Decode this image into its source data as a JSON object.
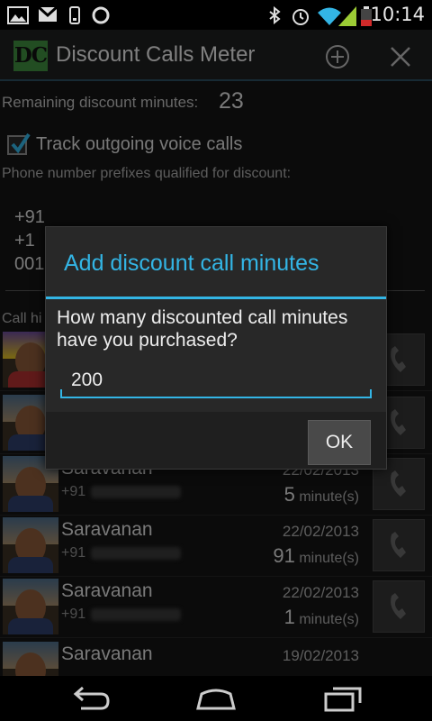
{
  "status_bar": {
    "time": "10:14",
    "left_icons": [
      "image-icon",
      "gmail-icon",
      "phone-battery-icon",
      "lifebuoy-icon"
    ],
    "right_icons": [
      "bluetooth-icon",
      "alarm-icon",
      "wifi-icon",
      "signal-icon",
      "battery-icon"
    ],
    "battery_color": "#d12a2a"
  },
  "action_bar": {
    "logo_text": "DC",
    "title": "Discount Calls Meter",
    "add_icon": "add-circle-icon",
    "close_icon": "close-icon",
    "accent": "#33b5e5"
  },
  "main": {
    "remaining_label": "Remaining discount minutes:",
    "remaining_value": "23",
    "track_label": "Track outgoing voice calls",
    "track_checked": true,
    "prefix_label": "Phone number prefixes qualified for discount:",
    "prefixes": [
      "+91",
      "+1",
      "001"
    ],
    "call_history_label": "Call hi"
  },
  "call_rows": [
    {
      "name": "",
      "number_prefix": "",
      "date": "",
      "minutes": "",
      "unit": ""
    },
    {
      "name": "",
      "number_prefix": "",
      "date": "",
      "minutes": "",
      "unit": ""
    },
    {
      "name": "Saravanan",
      "number_prefix": "+91",
      "date": "22/02/2013",
      "minutes": "5",
      "unit": "minute(s)"
    },
    {
      "name": "Saravanan",
      "number_prefix": "+91",
      "date": "22/02/2013",
      "minutes": "91",
      "unit": "minute(s)"
    },
    {
      "name": "Saravanan",
      "number_prefix": "+91",
      "date": "22/02/2013",
      "minutes": "1",
      "unit": "minute(s)"
    },
    {
      "name": "Saravanan",
      "number_prefix": "",
      "date": "19/02/2013",
      "minutes": "",
      "unit": ""
    }
  ],
  "dialog": {
    "title": "Add discount call minutes",
    "message": "How many discounted call minutes have you purchased?",
    "input_value": "200",
    "ok_label": "OK"
  },
  "nav_bar": {
    "icons": [
      "back-icon",
      "home-icon",
      "recent-apps-icon"
    ]
  }
}
